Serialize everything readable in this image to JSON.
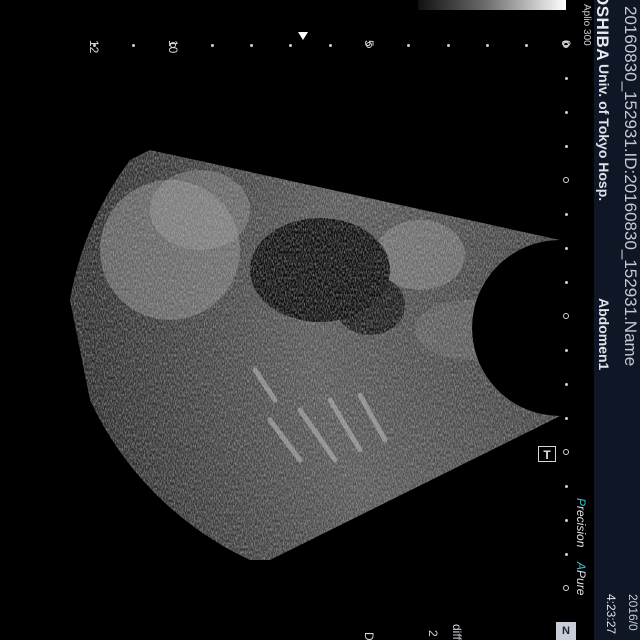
{
  "header": {
    "brand": "OSHIBA",
    "model": "Aplio 300",
    "patient_line": "20160830_152931.ID:20160830_152931.Name",
    "hospital": "Univ. of Tokyo Hosp.",
    "preset": "Abdomen1",
    "date": "2016/0",
    "time": "4:23:27"
  },
  "modes": {
    "precision_initial": "P",
    "precision_rest": "recision",
    "apure_initial": "A",
    "apure_rest": "Pure"
  },
  "side_labels": {
    "diff": "diff",
    "diff_value": "2",
    "d": "D"
  },
  "badge": "N",
  "t_marker": "T",
  "depth_scale": {
    "labels": [
      "0",
      "5",
      "10",
      "12"
    ]
  },
  "colors": {
    "header_bg": "#0f1626",
    "accent_cyan": "#3fc3cf"
  }
}
